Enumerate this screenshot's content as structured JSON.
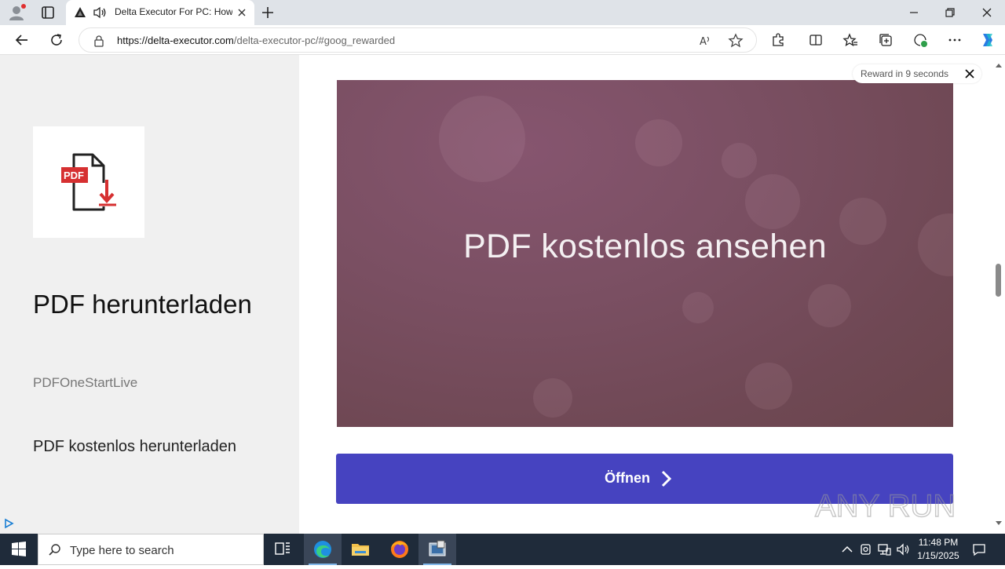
{
  "browser": {
    "tab": {
      "title": "Delta Executor For PC: How"
    },
    "address": {
      "url_host": "https://delta-executor.com",
      "url_path": "/delta-executor-pc/#goog_rewarded"
    }
  },
  "ad": {
    "title": "PDF herunterladen",
    "brand": "PDFOneStartLive",
    "description": "PDF kostenlos herunterladen",
    "logo_label": "PDF",
    "video_text": "PDF kostenlos ansehen",
    "reward_text": "Reward in 9 seconds",
    "open_button": "Öffnen"
  },
  "watermark": "ANY RUN",
  "taskbar": {
    "search_placeholder": "Type here to search",
    "time": "11:48 PM",
    "date": "1/15/2025"
  },
  "colors": {
    "accent": "#4643c0",
    "video_bg": "#7a4f62",
    "taskbar": "#1f2b3a",
    "pdf_red": "#d63031"
  }
}
